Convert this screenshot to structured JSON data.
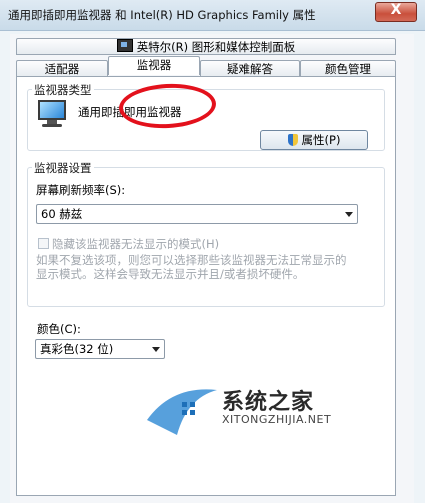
{
  "window": {
    "title": "通用即插即用监视器 和 Intel(R) HD Graphics Family 属性",
    "close_glyph": "X"
  },
  "tabs_top": [
    {
      "label": "英特尔(R) 图形和媒体控制面板",
      "icon": "intel-graphics-icon"
    }
  ],
  "tabs_bottom": [
    {
      "label": "适配器"
    },
    {
      "label": "监视器",
      "active": true
    },
    {
      "label": "疑难解答"
    },
    {
      "label": "颜色管理"
    }
  ],
  "monitor_type": {
    "group_label": "监视器类型",
    "icon": "monitor-icon",
    "name": "通用即插即用监视器",
    "properties_button": "属性(P)"
  },
  "monitor_settings": {
    "group_label": "监视器设置",
    "refresh_label": "屏幕刷新频率(S):",
    "refresh_value": "60 赫兹",
    "hide_modes_label": "隐藏该监视器无法显示的模式(H)",
    "hide_modes_checked": false,
    "help_line1": "如果不复选该项，则您可以选择那些该监视器无法正常显示的",
    "help_line2": "显示模式。这样会导致无法显示并且/或者损坏硬件。"
  },
  "colors": {
    "label": "颜色(C):",
    "value": "真彩色(32 位)"
  },
  "watermark": {
    "brand": "系统之家",
    "url": "XITONGZHIJIA.NET"
  },
  "annotation_color": "#e3111c"
}
